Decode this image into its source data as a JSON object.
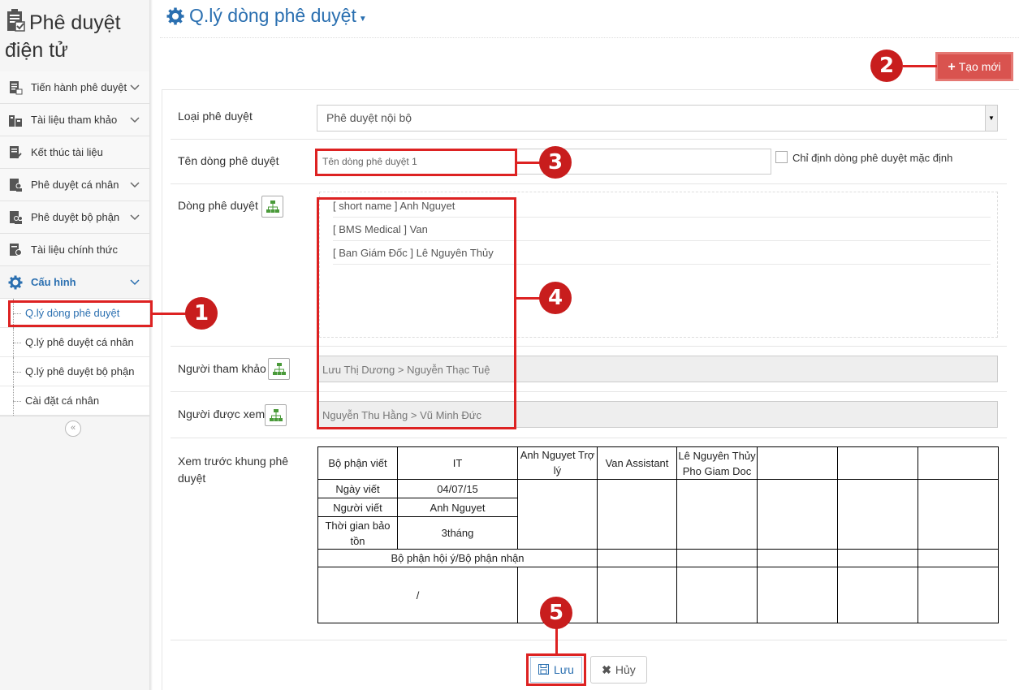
{
  "sidebar": {
    "app_title_line1": "Phê duyệt",
    "app_title_line2": "điện tử",
    "items": [
      {
        "label": "Tiến hành phê duyệt",
        "icon": "checklist-icon"
      },
      {
        "label": "Tài liệu tham khảo",
        "icon": "buildings-icon"
      },
      {
        "label": "Kết thúc tài liệu",
        "icon": "doc-check-icon"
      },
      {
        "label": "Phê duyệt cá nhân",
        "icon": "person-doc-icon"
      },
      {
        "label": "Phê duyệt bộ phận",
        "icon": "group-doc-icon"
      },
      {
        "label": "Tài liệu chính thức",
        "icon": "official-doc-icon"
      },
      {
        "label": "Cấu hình",
        "icon": "gear-icon"
      }
    ],
    "sub_items": [
      {
        "label": "Q.lý dòng phê duyệt"
      },
      {
        "label": "Q.lý phê duyệt cá nhân"
      },
      {
        "label": "Q.lý phê duyệt bộ phận"
      },
      {
        "label": "Cài đặt cá nhân"
      }
    ],
    "collapse_symbol": "«"
  },
  "header": {
    "title": "Q.lý dòng phê duyệt",
    "create_button": "Tạo mới"
  },
  "form": {
    "type_label": "Loại phê duyệt",
    "type_value": "Phê duyệt nội bộ",
    "name_label": "Tên dòng phê duyệt",
    "name_value": "Tên dòng phê duyệt 1",
    "default_checkbox_label": "Chỉ định dòng phê duyệt mặc định",
    "flow_label": "Dòng phê duyệt",
    "flow_items": [
      "[ short name ] Anh Nguyet",
      "[ BMS Medical ] Van",
      "[ Ban Giám Đốc ] Lê Nguyên Thủy"
    ],
    "reference_label": "Người tham khảo",
    "reference_value": "Lưu Thị Dương > Nguyễn Thạc Tuệ",
    "viewer_label": "Người được xem",
    "viewer_value": "Nguyễn Thu Hằng > Vũ Minh Đức",
    "preview_label": "Xem trước khung phê duyệt"
  },
  "preview": {
    "dept_label": "Bộ phận viết",
    "dept_value": "IT",
    "date_label": "Ngày viết",
    "date_value": "04/07/15",
    "writer_label": "Người viết",
    "writer_value": "Anh Nguyet",
    "retention_label": "Thời gian bảo tồn",
    "retention_value": "3tháng",
    "consult_label": "Bộ phận hội ý/Bộ phận nhận",
    "consult_value": "/",
    "approvers": [
      "Anh Nguyet Trợ lý",
      "Van Assistant",
      "Lê Nguyên Thủy Pho Giam Doc",
      "",
      "",
      ""
    ]
  },
  "buttons": {
    "save": "Lưu",
    "cancel": "Hủy"
  },
  "annotations": [
    "1",
    "2",
    "3",
    "4",
    "5"
  ],
  "colors": {
    "accent": "#2a6fb0",
    "danger": "#d9534f",
    "annotation": "#d22"
  }
}
